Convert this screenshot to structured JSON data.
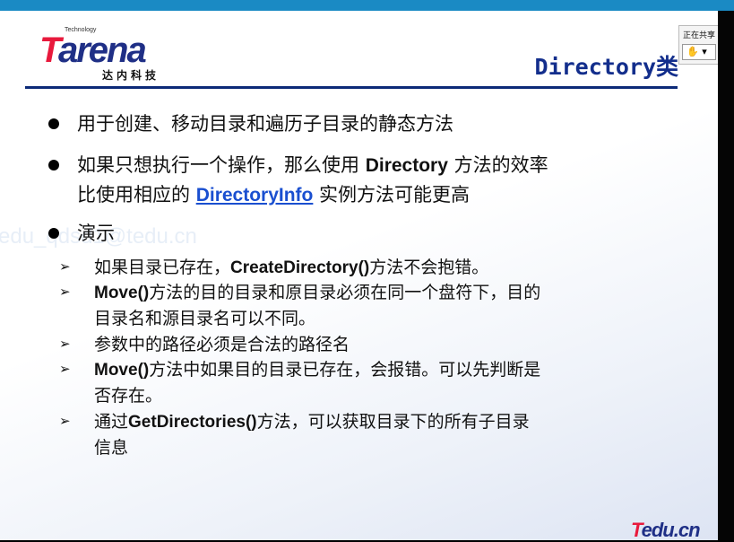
{
  "logo": {
    "technology": "Technology",
    "t": "T",
    "rest": "arena",
    "cn": "达内科技"
  },
  "title": "Directory类",
  "popup": {
    "label": "正在共享",
    "button": "✋ ▾"
  },
  "watermark": "edu_qdsd1@tedu.cn",
  "bullets": [
    {
      "text": "用于创建、移动目录和遍历子目录的静态方法"
    },
    {
      "a": "如果只想执行一个操作，那么使用 ",
      "b": "Directory",
      "c": " 方法的效率",
      "d": "比使用相应的 ",
      "link": "DirectoryInfo",
      "e": " 实例方法可能更高"
    },
    {
      "text": "演示"
    }
  ],
  "sub": [
    {
      "a": "如果目录已存在，",
      "b": "CreateDirectory()",
      "c": "方法不会抱错。"
    },
    {
      "b": "Move()",
      "c": "方法的目的目录和原目录必须在同一个盘符下，目的",
      "d": "目录名和源目录名可以不同。"
    },
    {
      "c": "参数中的路径必须是合法的路径名"
    },
    {
      "b": "Move()",
      "c": "方法中如果目的目录已存在，会报错。可以先判断是",
      "d": "否存在。"
    },
    {
      "a": "通过",
      "b": "GetDirectories()",
      "c": "方法，可以获取目录下的所有子目录",
      "d": "信息"
    }
  ],
  "footer_logo": {
    "t": "T",
    "rest": "edu.cn"
  },
  "colors": {
    "topbar": "#1a8ac4",
    "title": "#132e8c",
    "link": "#1a4fd0",
    "brand_red": "#e8193c"
  }
}
